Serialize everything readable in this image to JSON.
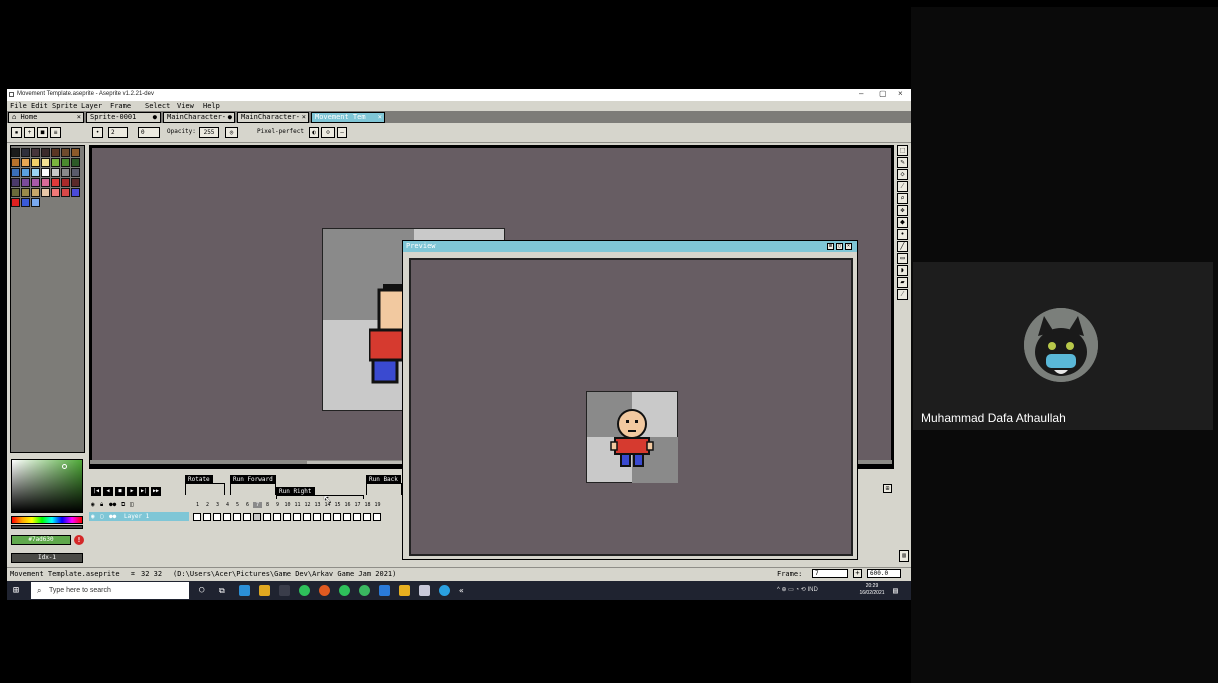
{
  "window": {
    "title": "Movement Template.aseprite - Aseprite v1.2.21-dev",
    "minimize": "–",
    "maximize": "▢",
    "close": "×"
  },
  "menu": [
    "File",
    "Edit",
    "Sprite",
    "Layer",
    "Frame",
    "Select",
    "View",
    "Help"
  ],
  "tabs": [
    {
      "label": "Home"
    },
    {
      "label": "Sprite-0001"
    },
    {
      "label": "MainCharacter-"
    },
    {
      "label": "MainCharacter-"
    },
    {
      "label": "Movement Tem"
    }
  ],
  "toolbar": {
    "brush_size": "2",
    "angle": "0",
    "opacity_label": "Opacity:",
    "opacity": "255",
    "pixel_perfect_label": "Pixel-perfect"
  },
  "color": {
    "hex": "#7ad630",
    "index": "Idx-1"
  },
  "palette": [
    "#1b1b1b",
    "#2f2f3b",
    "#46343a",
    "#3b2a2a",
    "#5a3623",
    "#6e4a2c",
    "#8c5a2a",
    "#b8722c",
    "#e8a854",
    "#f2d06a",
    "#f5e394",
    "#7ab33e",
    "#4a8a2e",
    "#2d5a27",
    "#3a6fb8",
    "#5aa0e0",
    "#9cd4f5",
    "#ffffff",
    "#c8c8c8",
    "#8a8a8a",
    "#5a5a6a",
    "#4a3a6a",
    "#7a4a9a",
    "#a85aa8",
    "#d86a98",
    "#e03a3a",
    "#a82a2a",
    "#5a2a2a",
    "#6a6a3a",
    "#9a8a4a",
    "#c8a86a",
    "#e8c8a8",
    "#f07878",
    "#d84848",
    "#4a4ad8",
    "#e02020",
    "#3a5ad8",
    "#7aaaf0"
  ],
  "timeline": {
    "tags": [
      "Rotate",
      "Run Forward",
      "Run Right",
      "Run Back"
    ],
    "layer": "Layer 1",
    "frames": [
      "1",
      "2",
      "3",
      "4",
      "5",
      "6",
      "7",
      "8",
      "9",
      "10",
      "11",
      "12",
      "13",
      "14",
      "15",
      "16",
      "17",
      "18",
      "19"
    ]
  },
  "preview": {
    "title": "Preview"
  },
  "status": {
    "file": "Movement Template.aseprite",
    "size": "32 32",
    "path": "(D:\\Users\\Acer\\Pictures\\Game Dev\\Arkav Game Jam 2021)",
    "frame_label": "Frame:",
    "frame": "7",
    "zoom": "600.0"
  },
  "taskbar": {
    "search_placeholder": "Type here to search",
    "lang": "IND",
    "time": "20:29",
    "date": "16/02/2021"
  },
  "participant": {
    "name": "Muhammad Dafa Athaullah"
  }
}
